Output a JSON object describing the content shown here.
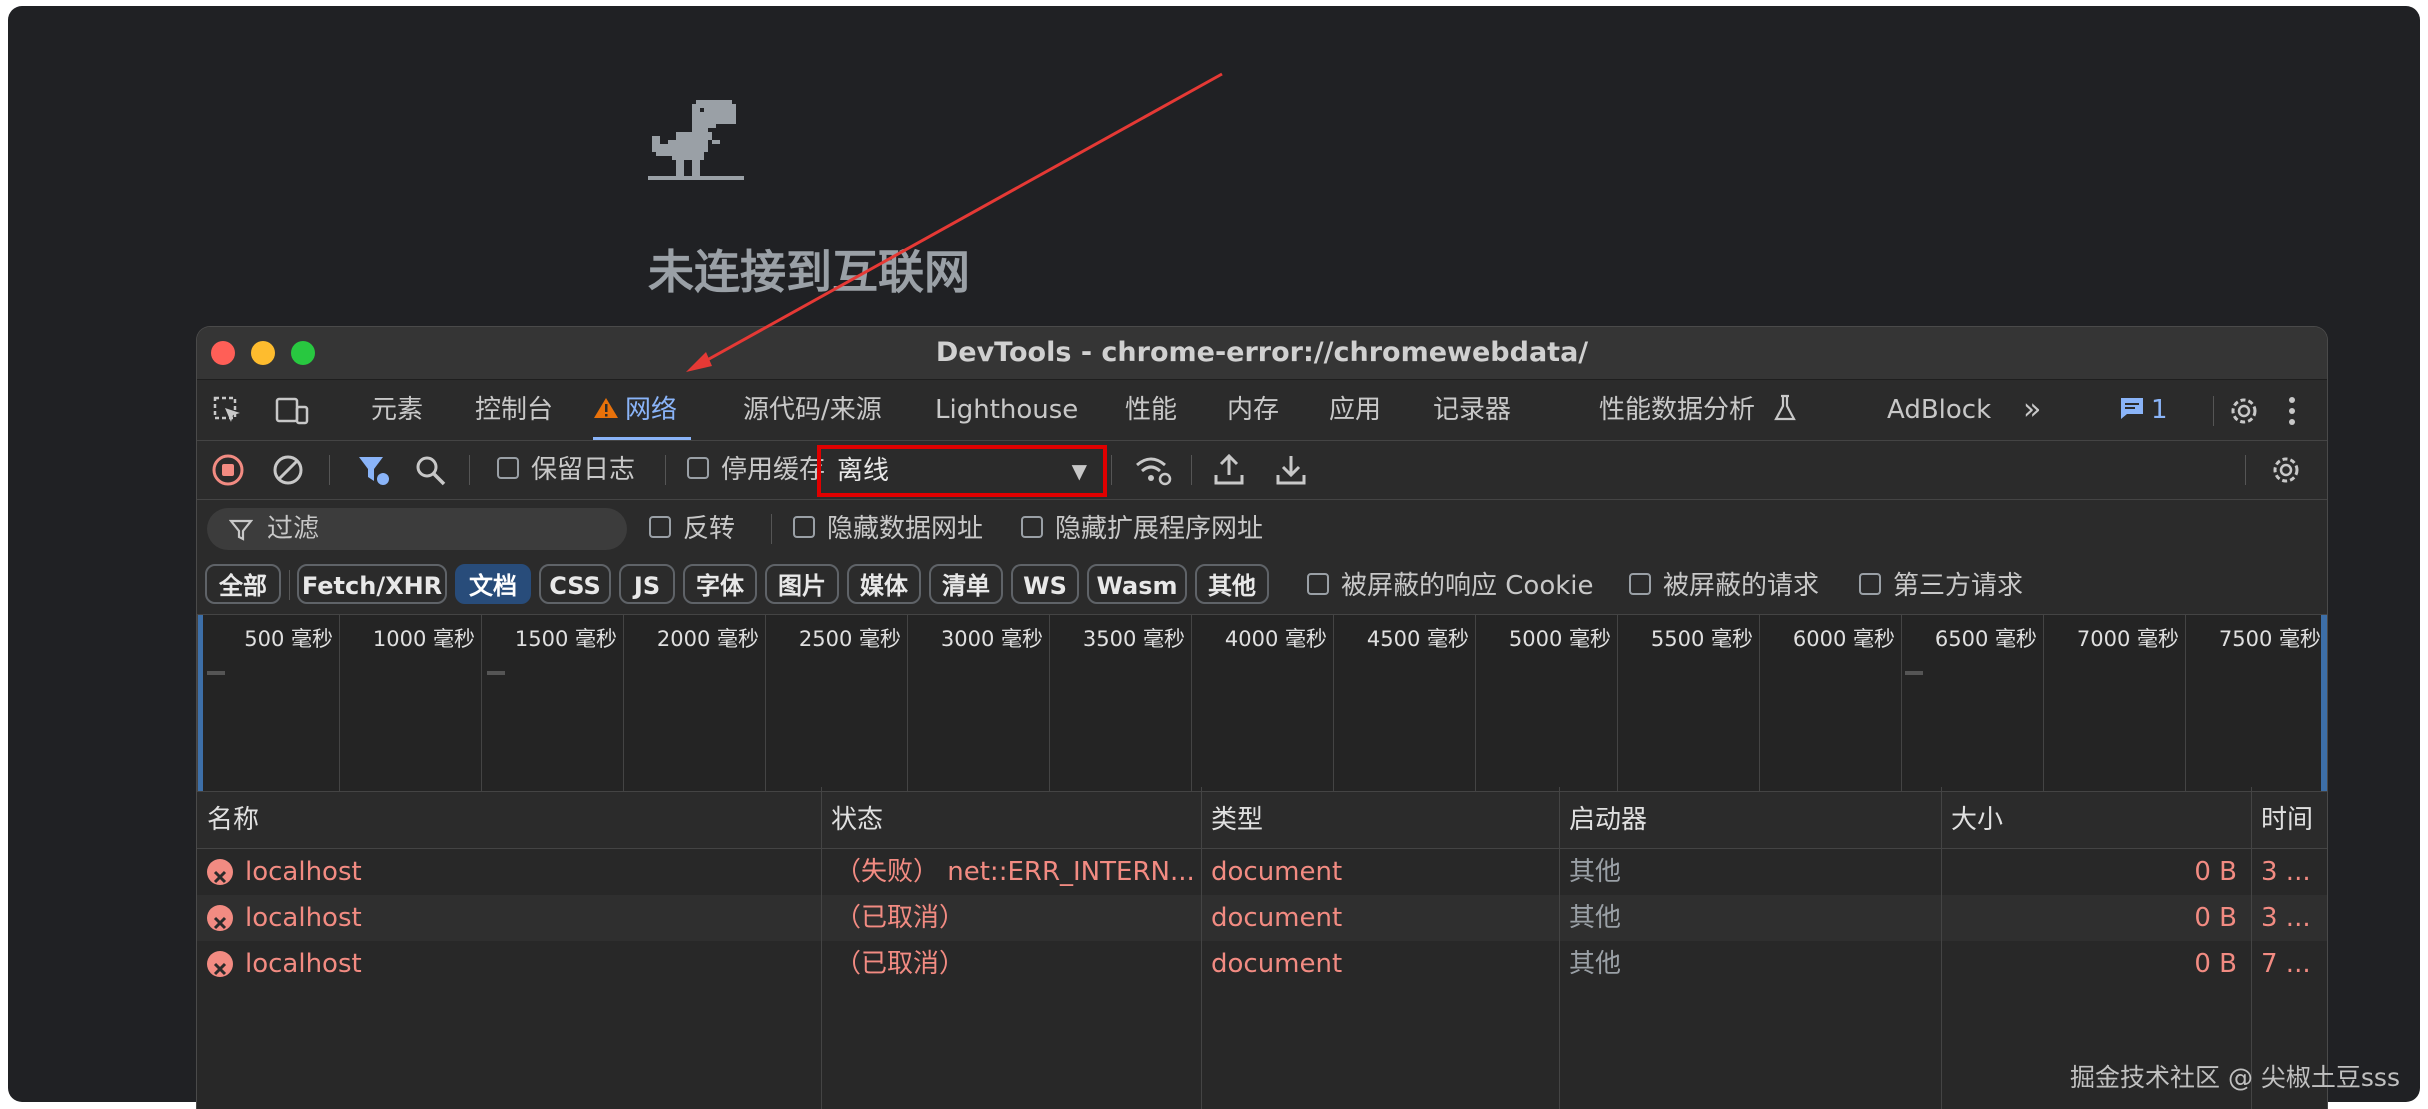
{
  "offline_page": {
    "title": "未连接到互联网"
  },
  "window": {
    "title": "DevTools - chrome-error://chromewebdata/"
  },
  "tabs": [
    {
      "label": "元素"
    },
    {
      "label": "控制台"
    },
    {
      "label": "网络"
    },
    {
      "label": "源代码/来源"
    },
    {
      "label": "Lighthouse"
    },
    {
      "label": "性能"
    },
    {
      "label": "内存"
    },
    {
      "label": "应用"
    },
    {
      "label": "记录器"
    },
    {
      "label": "性能数据分析"
    },
    {
      "label": "AdBlock"
    }
  ],
  "issues_count": "1",
  "toolbar": {
    "preserve_log": "保留日志",
    "disable_cache": "停用缓存",
    "throttle_value": "离线"
  },
  "filter": {
    "placeholder": "过滤",
    "invert": "反转",
    "hide_data_urls": "隐藏数据网址",
    "hide_extension_urls": "隐藏扩展程序网址"
  },
  "type_filters": [
    "全部",
    "Fetch/XHR",
    "文档",
    "CSS",
    "JS",
    "字体",
    "图片",
    "媒体",
    "清单",
    "WS",
    "Wasm",
    "其他"
  ],
  "active_type": "文档",
  "extra_filters": {
    "blocked_cookies": "被屏蔽的响应 Cookie",
    "blocked_requests": "被屏蔽的请求",
    "third_party": "第三方请求"
  },
  "overview_ticks": [
    "500 毫秒",
    "1000 毫秒",
    "1500 毫秒",
    "2000 毫秒",
    "2500 毫秒",
    "3000 毫秒",
    "3500 毫秒",
    "4000 毫秒",
    "4500 毫秒",
    "5000 毫秒",
    "5500 毫秒",
    "6000 毫秒",
    "6500 毫秒",
    "7000 毫秒",
    "7500 毫秒"
  ],
  "columns": {
    "name": "名称",
    "status": "状态",
    "type": "类型",
    "initiator": "启动器",
    "size": "大小",
    "time": "时间"
  },
  "requests": [
    {
      "name": "localhost",
      "status": "（失败） net::ERR_INTERN...",
      "type": "document",
      "initiator": "其他",
      "size": "0 B",
      "time": "3 ..."
    },
    {
      "name": "localhost",
      "status": "（已取消）",
      "type": "document",
      "initiator": "其他",
      "size": "0 B",
      "time": "3 ..."
    },
    {
      "name": "localhost",
      "status": "（已取消）",
      "type": "document",
      "initiator": "其他",
      "size": "0 B",
      "time": "7 ..."
    }
  ],
  "watermark": "掘金技术社区 @ 尖椒土豆sss",
  "colors": {
    "accent": "#8ab4f8",
    "error": "#f28b82",
    "highlight_box": "#e00000",
    "annotation_arrow": "#e53935"
  }
}
